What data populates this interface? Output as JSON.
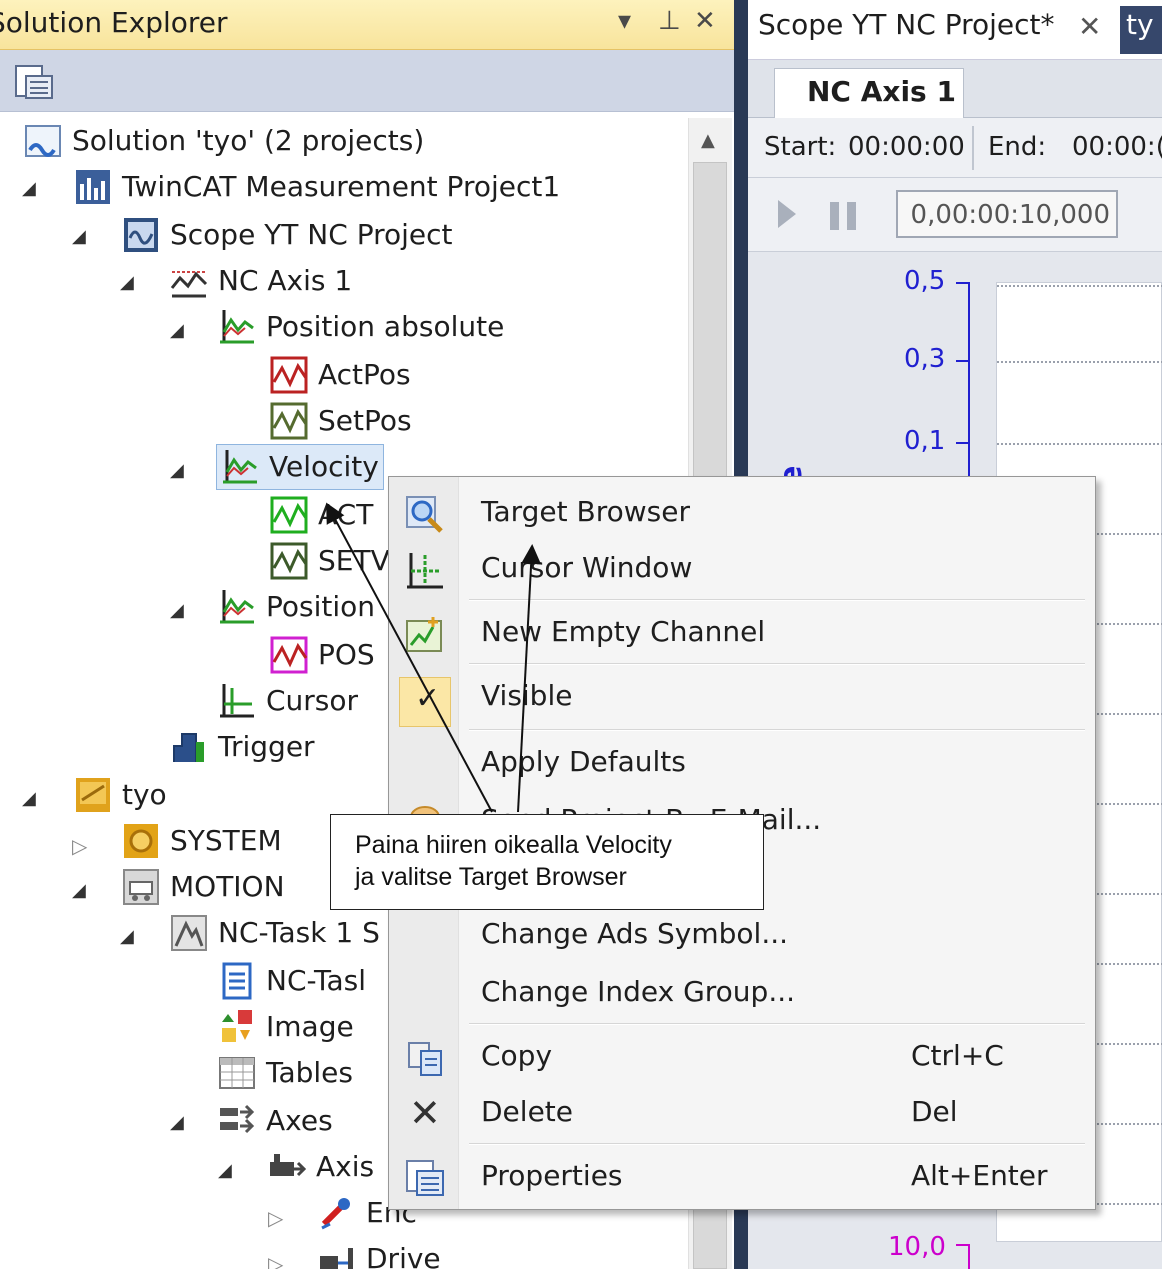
{
  "solution_explorer": {
    "title": "Solution Explorer",
    "controls": {
      "dropdown": "▾",
      "pin": "⊥",
      "close": "✕"
    },
    "tree": [
      {
        "label": "Solution 'tyo' (2 projects)",
        "icon": "solution-icon"
      },
      {
        "label": "TwinCAT Measurement Project1",
        "icon": "measurement-project-icon"
      },
      {
        "label": "Scope YT NC Project",
        "icon": "scope-project-icon"
      },
      {
        "label": "NC Axis 1",
        "icon": "chart-icon"
      },
      {
        "label": "Position absolute",
        "icon": "axis-icon"
      },
      {
        "label": "ActPos",
        "icon": "channel-icon"
      },
      {
        "label": "SetPos",
        "icon": "channel-icon"
      },
      {
        "label": "Velocity",
        "icon": "axis-icon"
      },
      {
        "label": "ACT",
        "icon": "channel-icon"
      },
      {
        "label": "SETV",
        "icon": "channel-icon"
      },
      {
        "label": "Position",
        "icon": "axis-icon"
      },
      {
        "label": "POS",
        "icon": "channel-icon"
      },
      {
        "label": "Cursor",
        "icon": "cursor-icon"
      },
      {
        "label": "Trigger",
        "icon": "trigger-icon"
      },
      {
        "label": "tyo",
        "icon": "twincat-project-icon"
      },
      {
        "label": "SYSTEM",
        "icon": "system-icon"
      },
      {
        "label": "MOTION",
        "icon": "motion-icon"
      },
      {
        "label": "NC-Task 1 S",
        "icon": "nc-task-icon"
      },
      {
        "label": "NC-Tasl",
        "icon": "nc-task-info-icon"
      },
      {
        "label": "Image",
        "icon": "image-icon"
      },
      {
        "label": "Tables",
        "icon": "tables-icon"
      },
      {
        "label": "Axes",
        "icon": "axes-icon"
      },
      {
        "label": "Axis",
        "icon": "axis-item-icon"
      },
      {
        "label": "Enc",
        "icon": "encoder-icon"
      },
      {
        "label": "Drive",
        "icon": "drive-icon"
      }
    ]
  },
  "scope_document": {
    "tab_title": "Scope YT NC Project*",
    "second_tab": "ty",
    "chart_tab": "NC Axis 1",
    "start_label": "Start:",
    "start_value": "00:00:00",
    "end_label": "End:",
    "end_value": "00:00:(",
    "duration": "0,00:00:10,000",
    "y_axis_title": "absolute",
    "y_ticks": [
      "0,5",
      "0,3",
      "0,1"
    ],
    "second_axis_tick": "10,0",
    "colors": {
      "primary_axis": "#2020d0",
      "secondary_axis": "#cc00cc"
    }
  },
  "context_menu": {
    "items": [
      {
        "label": "Target Browser",
        "shortcut": "",
        "icon": "magnifier-icon"
      },
      {
        "label": "Cursor Window",
        "shortcut": "",
        "icon": "cursor-window-icon"
      },
      {
        "label": "New Empty Channel",
        "shortcut": "",
        "icon": "new-channel-icon"
      },
      {
        "label": "Visible",
        "shortcut": "",
        "icon": "check-icon",
        "checked": true
      },
      {
        "label": "Apply Defaults",
        "shortcut": "",
        "icon": ""
      },
      {
        "label": "Send Project By E-Mail...",
        "shortcut": "",
        "icon": "mail-icon"
      },
      {
        "label": "Change Ads Symbol...",
        "shortcut": "",
        "icon": ""
      },
      {
        "label": "Change Index Group...",
        "shortcut": "",
        "icon": ""
      },
      {
        "label": "Copy",
        "shortcut": "Ctrl+C",
        "icon": "copy-icon"
      },
      {
        "label": "Delete",
        "shortcut": "Del",
        "icon": "delete-icon"
      },
      {
        "label": "Properties",
        "shortcut": "Alt+Enter",
        "icon": "properties-icon"
      }
    ]
  },
  "callout": {
    "line1": "Paina hiiren oikealla Velocity",
    "line2": "ja valitse Target Browser"
  }
}
